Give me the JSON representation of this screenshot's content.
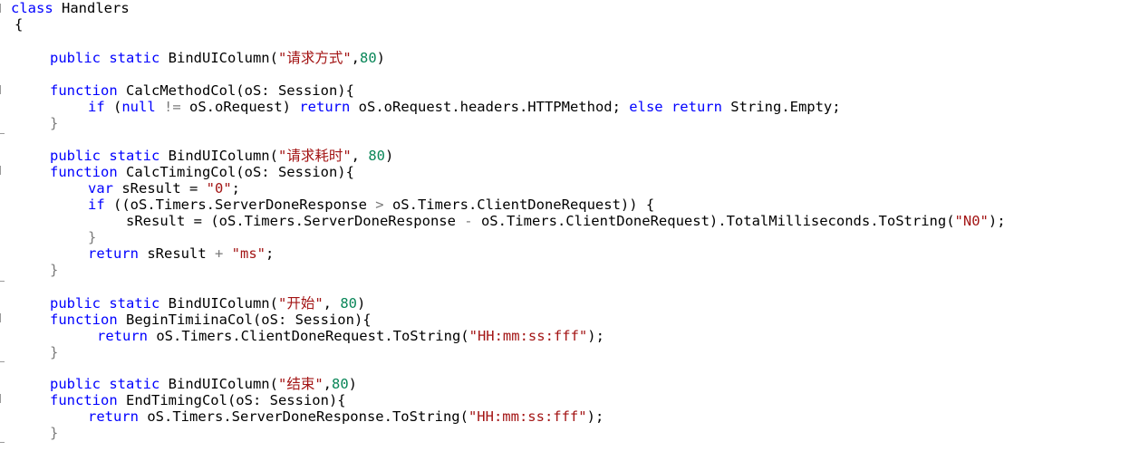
{
  "code": {
    "class_kw": "class",
    "class_name": " Handlers",
    "open_brace": "{",
    "kw_public_static": "public static",
    "kw_function": "function",
    "kw_if": "if",
    "kw_var": "var",
    "kw_return": "return",
    "kw_null": "null",
    "kw_else": "else",
    "col1": {
      "decl": " BindUIColumn(",
      "title": "\"请求方式\"",
      "sep": ",",
      "width": "80",
      "close": ")"
    },
    "fn1": {
      "sig": " CalcMethodCol(oS: Session){",
      "body_pre": " (",
      "body_ne": " != ",
      "body_cond": "oS.oRequest) ",
      "body_expr": " oS.oRequest.headers.HTTPMethod; ",
      "body_else_ret": " String.Empty;",
      "close": "}"
    },
    "col2": {
      "decl": " BindUIColumn(",
      "title": "\"请求耗时\"",
      "sep": ", ",
      "width": "80",
      "close": ")"
    },
    "fn2": {
      "sig": " CalcTimingCol(oS: Session){",
      "var_decl": " sResult = ",
      "var_init": "\"0\"",
      "semi": ";",
      "if_pre": " ((oS.Timers.ServerDoneResponse ",
      "gt": ">",
      "if_post": " oS.Timers.ClientDoneRequest)) {",
      "assign": "sResult = (oS.Timers.ServerDoneResponse ",
      "minus": "-",
      "assign_post": " oS.Timers.ClientDoneRequest).TotalMilliseconds.ToString(",
      "fmt": "\"N0\"",
      "assign_end": ");",
      "inner_close": "}",
      "ret_expr": " sResult ",
      "plus": "+",
      "ret_str": " \"ms\"",
      "close": "}"
    },
    "col3": {
      "decl": " BindUIColumn(",
      "title": "\"开始\"",
      "sep": ", ",
      "width": "80",
      "close": ")"
    },
    "fn3": {
      "sig": " BeginTimiinaCol(oS: Session){",
      "ret_expr": " oS.Timers.ClientDoneRequest.ToString(",
      "fmt": "\"HH:mm:ss:fff\"",
      "end": ");",
      "close": "}"
    },
    "col4": {
      "decl": " BindUIColumn(",
      "title": "\"结束\"",
      "sep": ",",
      "width": "80",
      "close": ")"
    },
    "fn4": {
      "sig": " EndTimingCol(oS: Session){",
      "ret_expr": " oS.Timers.ServerDoneResponse.ToString(",
      "fmt": "\"HH:mm:ss:fff\"",
      "end": ");",
      "close": "}"
    }
  },
  "colors": {
    "keyword": "#0000ff",
    "string": "#a31515",
    "number": "#098658",
    "operator": "#7a7a7a"
  }
}
